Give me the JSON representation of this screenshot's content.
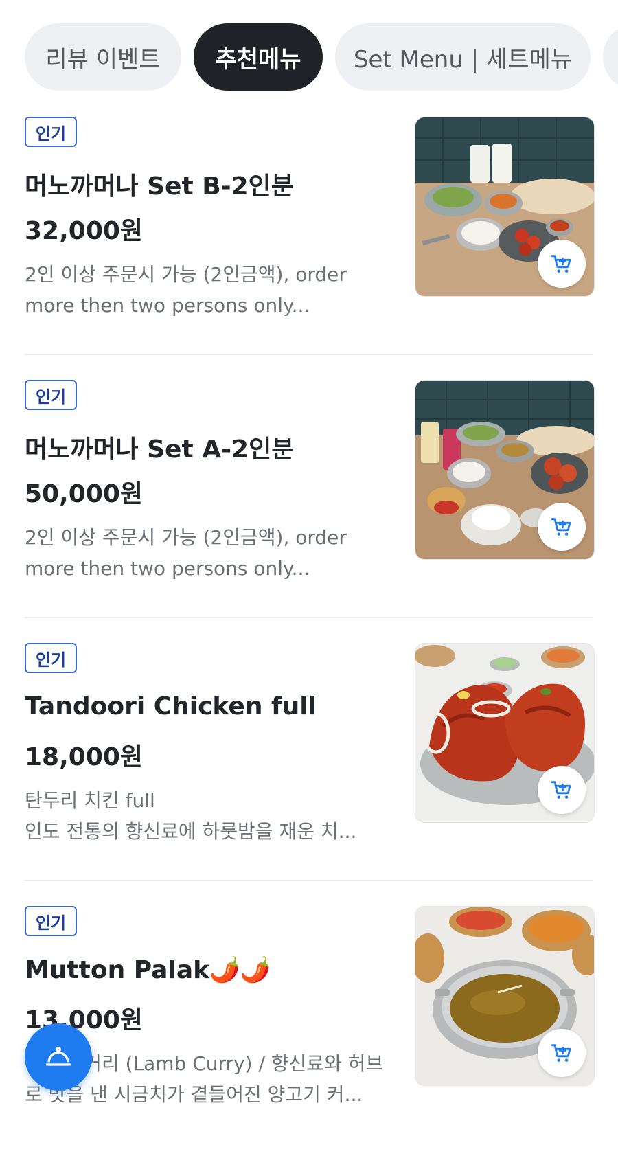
{
  "tabs": [
    {
      "label": "리뷰 이벤트"
    },
    {
      "label": "추천메뉴"
    },
    {
      "label": "Set Menu | 세트메뉴"
    }
  ],
  "items": [
    {
      "badge": "인기",
      "name": "머노까머나 Set B-2인분",
      "price": "32,000원",
      "desc_line1": "2인 이상 주문시 가능 (2인금액), order",
      "desc_line2": "more then two persons only..."
    },
    {
      "badge": "인기",
      "name": "머노까머나 Set A-2인분",
      "price": "50,000원",
      "desc_line1": "2인 이상 주문시 가능 (2인금액), order",
      "desc_line2": "more then two persons only..."
    },
    {
      "badge": "인기",
      "name": "Tandoori Chicken full",
      "price": "18,000원",
      "desc_line1": "탄두리 치킨 full",
      "desc_line2": "인도 전통의 향신료에 하룻밤을 재운 치..."
    },
    {
      "badge": "인기",
      "name": "Mutton Palak🌶️🌶️",
      "price": "13,000원",
      "desc_line1": "양고기 커리 (Lamb Curry) / 향신료와 허브",
      "desc_line2": "로 맛을 낸 시금치가 곁들어진 양고기 커..."
    }
  ],
  "icons": {
    "cart": "add-to-cart-icon",
    "fab": "cloche-icon"
  },
  "colors": {
    "accent": "#1f7cf0",
    "active_tab": "#1f2226",
    "badge_border": "#3a66d6"
  }
}
